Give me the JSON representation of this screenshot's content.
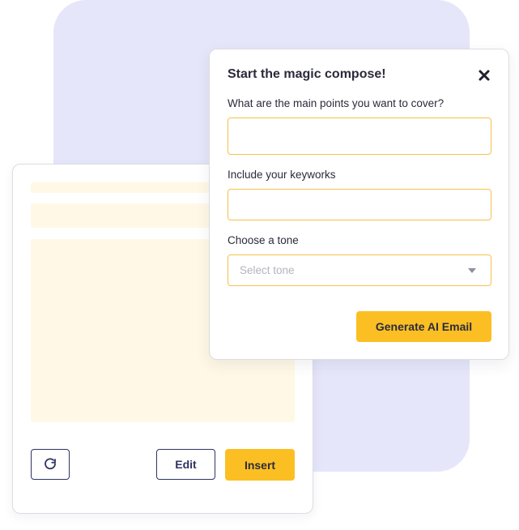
{
  "compose": {
    "title": "Start the magic compose!",
    "close_icon": "close-icon",
    "fields": {
      "main_points": {
        "label": "What are the main points you want to cover?",
        "value": "",
        "placeholder": ""
      },
      "keywords": {
        "label": "Include your keyworks",
        "value": "",
        "placeholder": ""
      },
      "tone": {
        "label": "Choose a tone",
        "placeholder": "Select tone",
        "icon": "chevron-down-icon"
      }
    },
    "generate_label": "Generate AI Email"
  },
  "email_card": {
    "refresh_icon": "refresh-icon",
    "edit_label": "Edit",
    "insert_label": "Insert"
  },
  "colors": {
    "background_shape": "#e6e6fa",
    "accent": "#fbbf24",
    "field_border": "#f6c14b",
    "placeholder_fill": "#fff8e6",
    "navy": "#2e3462"
  }
}
